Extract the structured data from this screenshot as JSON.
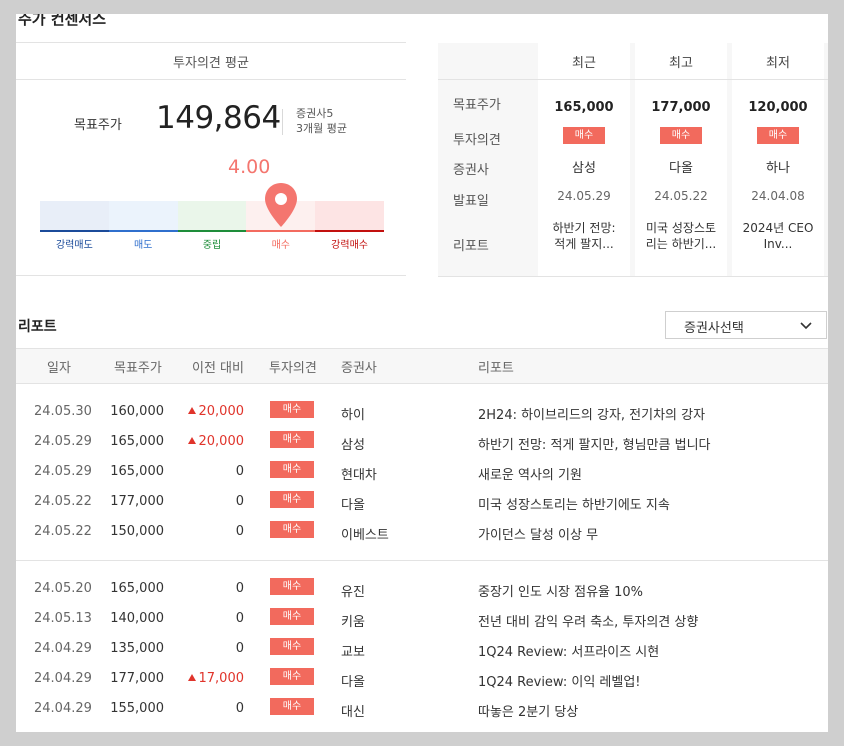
{
  "page_title": "주가 컨센서스",
  "consensus": {
    "subtitle": "투자의견 평균",
    "target_label": "목표주가",
    "target_value": "149,864",
    "brokers_line": "증권사5",
    "period_line": "3개월 평균",
    "score": "4.00",
    "gauge": {
      "scale_min": 1,
      "scale_max": 5,
      "labels": [
        "강력매도",
        "매도",
        "중립",
        "매수",
        "강력매수"
      ],
      "fill_colors": [
        "#e8eef8",
        "#ebf3fc",
        "#eaf6ea",
        "#fdf0ef",
        "#fde4e4"
      ],
      "line_colors": [
        "#1b4b9a",
        "#2f6fcd",
        "#1e8d3a",
        "#f36b5f",
        "#c2100e"
      ],
      "label_colors": [
        "#1b4b9a",
        "#2f6fcd",
        "#1e8d3a",
        "#f36b5f",
        "#c2100e"
      ],
      "pin_color": "#f4766f"
    }
  },
  "recent": {
    "headers": [
      "최근",
      "최고",
      "최저"
    ],
    "row_labels": [
      "목표주가",
      "투자의견",
      "증권사",
      "발표일",
      "리포트"
    ],
    "columns": [
      {
        "target": "165,000",
        "opinion": "매수",
        "broker": "삼성",
        "date": "24.05.29",
        "report_l1": "하반기 전망:",
        "report_l2": "적게 팔지..."
      },
      {
        "target": "177,000",
        "opinion": "매수",
        "broker": "다올",
        "date": "24.05.22",
        "report_l1": "미국 성장스토",
        "report_l2": "리는 하반기..."
      },
      {
        "target": "120,000",
        "opinion": "매수",
        "broker": "하나",
        "date": "24.04.08",
        "report_l1": "2024년 CEO",
        "report_l2": "Inv..."
      }
    ]
  },
  "reports": {
    "title": "리포트",
    "select_label": "증권사선택",
    "columns": [
      "일자",
      "목표주가",
      "이전 대비",
      "투자의견",
      "증권사",
      "리포트"
    ],
    "rows": [
      {
        "date": "24.05.30",
        "target": "160,000",
        "change": "20,000",
        "up": true,
        "opinion": "매수",
        "broker": "하이",
        "title": "2H24: 하이브리드의 강자, 전기차의 강자"
      },
      {
        "date": "24.05.29",
        "target": "165,000",
        "change": "20,000",
        "up": true,
        "opinion": "매수",
        "broker": "삼성",
        "title": "하반기 전망: 적게 팔지만, 형님만큼 법니다"
      },
      {
        "date": "24.05.29",
        "target": "165,000",
        "change": "0",
        "up": false,
        "opinion": "매수",
        "broker": "현대차",
        "title": "새로운 역사의 기원"
      },
      {
        "date": "24.05.22",
        "target": "177,000",
        "change": "0",
        "up": false,
        "opinion": "매수",
        "broker": "다올",
        "title": "미국 성장스토리는 하반기에도 지속"
      },
      {
        "date": "24.05.22",
        "target": "150,000",
        "change": "0",
        "up": false,
        "opinion": "매수",
        "broker": "이베스트",
        "title": "가이던스 달성 이상 무"
      },
      {
        "date": "24.05.20",
        "target": "165,000",
        "change": "0",
        "up": false,
        "opinion": "매수",
        "broker": "유진",
        "title": "중장기 인도 시장 점유율 10%"
      },
      {
        "date": "24.05.13",
        "target": "140,000",
        "change": "0",
        "up": false,
        "opinion": "매수",
        "broker": "키움",
        "title": "전년 대비 감익 우려 축소, 투자의견 상향"
      },
      {
        "date": "24.04.29",
        "target": "135,000",
        "change": "0",
        "up": false,
        "opinion": "매수",
        "broker": "교보",
        "title": "1Q24 Review: 서프라이즈 시현"
      },
      {
        "date": "24.04.29",
        "target": "177,000",
        "change": "17,000",
        "up": true,
        "opinion": "매수",
        "broker": "다올",
        "title": "1Q24 Review: 이익 레벨업!"
      },
      {
        "date": "24.04.29",
        "target": "155,000",
        "change": "0",
        "up": false,
        "opinion": "매수",
        "broker": "대신",
        "title": "따놓은 2분기 당상"
      }
    ]
  }
}
